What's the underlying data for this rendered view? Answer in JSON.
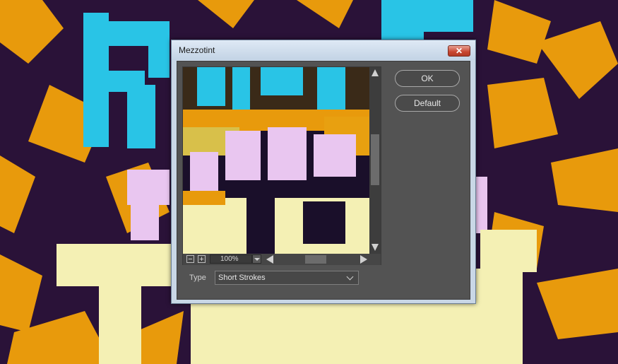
{
  "window": {
    "title": "Mezzotint",
    "close_glyph": "✕"
  },
  "preview": {
    "zoom_value": "100%",
    "zoom_out_glyph": "−",
    "zoom_in_glyph": "+"
  },
  "buttons": {
    "ok_label": "OK",
    "default_label": "Default"
  },
  "type_field": {
    "label": "Type",
    "selected": "Short Strokes"
  },
  "colors": {
    "panel": "#535353",
    "title_bar": "#c9d7e6",
    "close_button": "#c8452f",
    "art_purple": "#2a1238",
    "art_orange": "#e89a0c",
    "art_cyan": "#29c4e6",
    "art_cream": "#f4f0b4",
    "art_pink": "#e9c6f0"
  }
}
